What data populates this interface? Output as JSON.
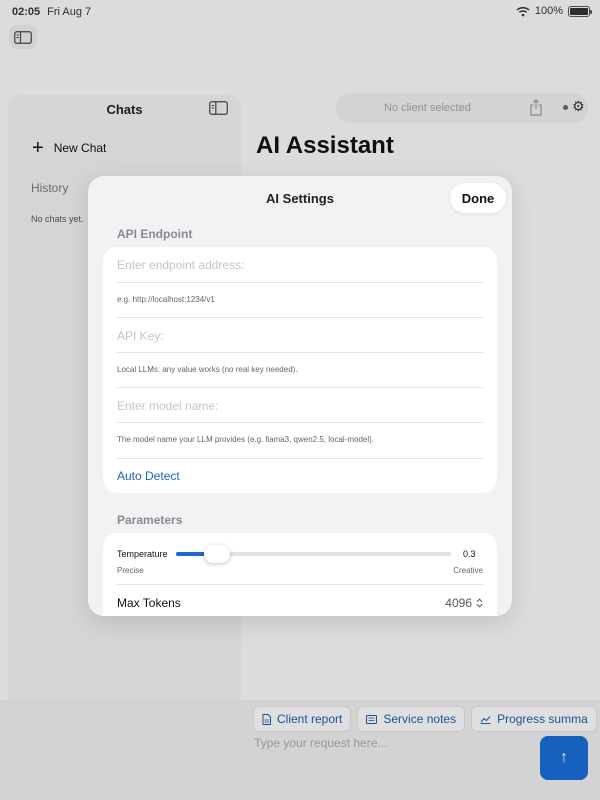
{
  "status_bar": {
    "time": "02:05",
    "date": "Fri Aug 7",
    "battery": "100%",
    "battery_level": 1.0
  },
  "sidebar": {
    "title": "Chats",
    "new_chat": "New Chat",
    "history_label": "History",
    "empty_text": "No chats yet."
  },
  "main": {
    "client_status": "No client selected",
    "title": "AI Assistant",
    "quick_actions": [
      "Client report",
      "Service notes",
      "Progress summa"
    ],
    "request_placeholder": "Type your request here..."
  },
  "settings": {
    "title": "AI Settings",
    "done_label": "Done",
    "api_section": "API Endpoint",
    "endpoint_placeholder": "Enter endpoint address:",
    "endpoint_hint": "e.g. http://localhost:1234/v1",
    "key_placeholder": "API Key:",
    "key_hint": "Local LLMs: any value works (no real key needed).",
    "model_placeholder": "Enter model name:",
    "model_hint": "The model name your LLM provides (e.g. llama3, qwen2.5, local-model).",
    "auto_detect": "Auto Detect",
    "params_section": "Parameters",
    "temperature_label": "Temperature",
    "temperature_value": "0.3",
    "temperature_min": 0,
    "temperature_max": 2,
    "temperature_min_label": "Precise",
    "temperature_max_label": "Creative",
    "max_tokens_label": "Max Tokens",
    "max_tokens_value": "4096"
  },
  "colors": {
    "accent": "#1b6ad0",
    "link": "#1e64c0"
  }
}
